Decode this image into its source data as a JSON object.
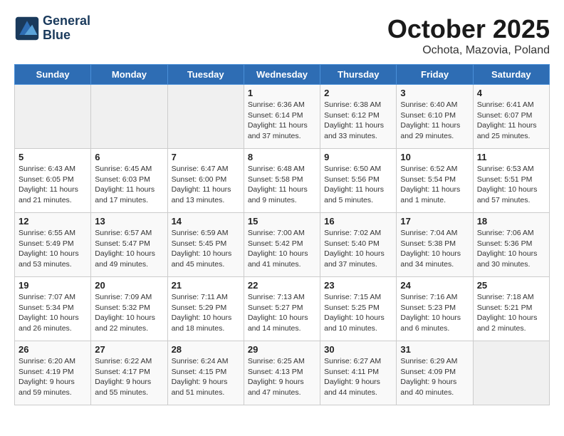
{
  "header": {
    "logo_line1": "General",
    "logo_line2": "Blue",
    "month": "October 2025",
    "location": "Ochota, Mazovia, Poland"
  },
  "days_of_week": [
    "Sunday",
    "Monday",
    "Tuesday",
    "Wednesday",
    "Thursday",
    "Friday",
    "Saturday"
  ],
  "weeks": [
    [
      {
        "day": "",
        "content": ""
      },
      {
        "day": "",
        "content": ""
      },
      {
        "day": "",
        "content": ""
      },
      {
        "day": "1",
        "content": "Sunrise: 6:36 AM\nSunset: 6:14 PM\nDaylight: 11 hours\nand 37 minutes."
      },
      {
        "day": "2",
        "content": "Sunrise: 6:38 AM\nSunset: 6:12 PM\nDaylight: 11 hours\nand 33 minutes."
      },
      {
        "day": "3",
        "content": "Sunrise: 6:40 AM\nSunset: 6:10 PM\nDaylight: 11 hours\nand 29 minutes."
      },
      {
        "day": "4",
        "content": "Sunrise: 6:41 AM\nSunset: 6:07 PM\nDaylight: 11 hours\nand 25 minutes."
      }
    ],
    [
      {
        "day": "5",
        "content": "Sunrise: 6:43 AM\nSunset: 6:05 PM\nDaylight: 11 hours\nand 21 minutes."
      },
      {
        "day": "6",
        "content": "Sunrise: 6:45 AM\nSunset: 6:03 PM\nDaylight: 11 hours\nand 17 minutes."
      },
      {
        "day": "7",
        "content": "Sunrise: 6:47 AM\nSunset: 6:00 PM\nDaylight: 11 hours\nand 13 minutes."
      },
      {
        "day": "8",
        "content": "Sunrise: 6:48 AM\nSunset: 5:58 PM\nDaylight: 11 hours\nand 9 minutes."
      },
      {
        "day": "9",
        "content": "Sunrise: 6:50 AM\nSunset: 5:56 PM\nDaylight: 11 hours\nand 5 minutes."
      },
      {
        "day": "10",
        "content": "Sunrise: 6:52 AM\nSunset: 5:54 PM\nDaylight: 11 hours\nand 1 minute."
      },
      {
        "day": "11",
        "content": "Sunrise: 6:53 AM\nSunset: 5:51 PM\nDaylight: 10 hours\nand 57 minutes."
      }
    ],
    [
      {
        "day": "12",
        "content": "Sunrise: 6:55 AM\nSunset: 5:49 PM\nDaylight: 10 hours\nand 53 minutes."
      },
      {
        "day": "13",
        "content": "Sunrise: 6:57 AM\nSunset: 5:47 PM\nDaylight: 10 hours\nand 49 minutes."
      },
      {
        "day": "14",
        "content": "Sunrise: 6:59 AM\nSunset: 5:45 PM\nDaylight: 10 hours\nand 45 minutes."
      },
      {
        "day": "15",
        "content": "Sunrise: 7:00 AM\nSunset: 5:42 PM\nDaylight: 10 hours\nand 41 minutes."
      },
      {
        "day": "16",
        "content": "Sunrise: 7:02 AM\nSunset: 5:40 PM\nDaylight: 10 hours\nand 37 minutes."
      },
      {
        "day": "17",
        "content": "Sunrise: 7:04 AM\nSunset: 5:38 PM\nDaylight: 10 hours\nand 34 minutes."
      },
      {
        "day": "18",
        "content": "Sunrise: 7:06 AM\nSunset: 5:36 PM\nDaylight: 10 hours\nand 30 minutes."
      }
    ],
    [
      {
        "day": "19",
        "content": "Sunrise: 7:07 AM\nSunset: 5:34 PM\nDaylight: 10 hours\nand 26 minutes."
      },
      {
        "day": "20",
        "content": "Sunrise: 7:09 AM\nSunset: 5:32 PM\nDaylight: 10 hours\nand 22 minutes."
      },
      {
        "day": "21",
        "content": "Sunrise: 7:11 AM\nSunset: 5:29 PM\nDaylight: 10 hours\nand 18 minutes."
      },
      {
        "day": "22",
        "content": "Sunrise: 7:13 AM\nSunset: 5:27 PM\nDaylight: 10 hours\nand 14 minutes."
      },
      {
        "day": "23",
        "content": "Sunrise: 7:15 AM\nSunset: 5:25 PM\nDaylight: 10 hours\nand 10 minutes."
      },
      {
        "day": "24",
        "content": "Sunrise: 7:16 AM\nSunset: 5:23 PM\nDaylight: 10 hours\nand 6 minutes."
      },
      {
        "day": "25",
        "content": "Sunrise: 7:18 AM\nSunset: 5:21 PM\nDaylight: 10 hours\nand 2 minutes."
      }
    ],
    [
      {
        "day": "26",
        "content": "Sunrise: 6:20 AM\nSunset: 4:19 PM\nDaylight: 9 hours\nand 59 minutes."
      },
      {
        "day": "27",
        "content": "Sunrise: 6:22 AM\nSunset: 4:17 PM\nDaylight: 9 hours\nand 55 minutes."
      },
      {
        "day": "28",
        "content": "Sunrise: 6:24 AM\nSunset: 4:15 PM\nDaylight: 9 hours\nand 51 minutes."
      },
      {
        "day": "29",
        "content": "Sunrise: 6:25 AM\nSunset: 4:13 PM\nDaylight: 9 hours\nand 47 minutes."
      },
      {
        "day": "30",
        "content": "Sunrise: 6:27 AM\nSunset: 4:11 PM\nDaylight: 9 hours\nand 44 minutes."
      },
      {
        "day": "31",
        "content": "Sunrise: 6:29 AM\nSunset: 4:09 PM\nDaylight: 9 hours\nand 40 minutes."
      },
      {
        "day": "",
        "content": ""
      }
    ]
  ]
}
